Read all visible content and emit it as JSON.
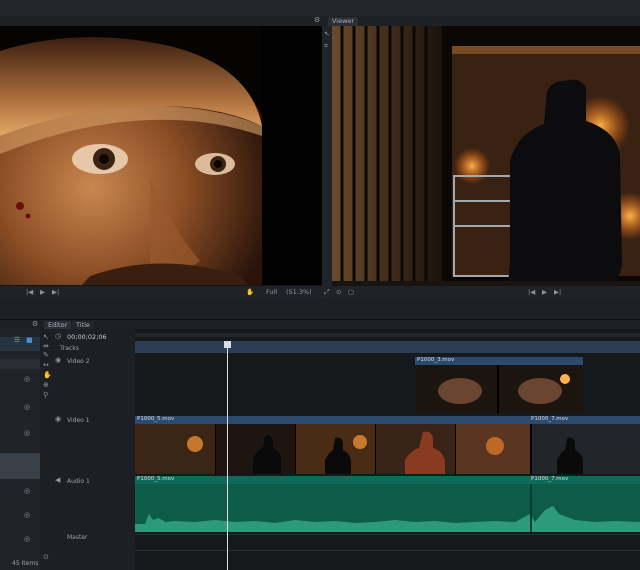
{
  "tabs": {
    "viewer": "Viewer",
    "editor": "Editor",
    "title": "Title"
  },
  "viewer_left": {
    "quality": "Full",
    "zoom": "(51.3%)"
  },
  "timeline": {
    "timecode": "00;00;02;06",
    "tracks_label": "Tracks",
    "video2_label": "Video 2",
    "video1_label": "Video 1",
    "audio1_label": "Audio 1",
    "master_label": "Master",
    "clip_v2": "P1000_3.mov",
    "clip_v1a": "P1000_5.mov",
    "clip_v1b": "P1000_7.mov",
    "clip_a1a": "P1000_5.mov",
    "clip_a1b": "P1000_7.mov"
  },
  "media": {
    "items_count": "45 Items"
  },
  "colors": {
    "audio_clip": "#0f6b57",
    "video_header": "#2c4a6e",
    "playhead": "#d8dde3"
  }
}
